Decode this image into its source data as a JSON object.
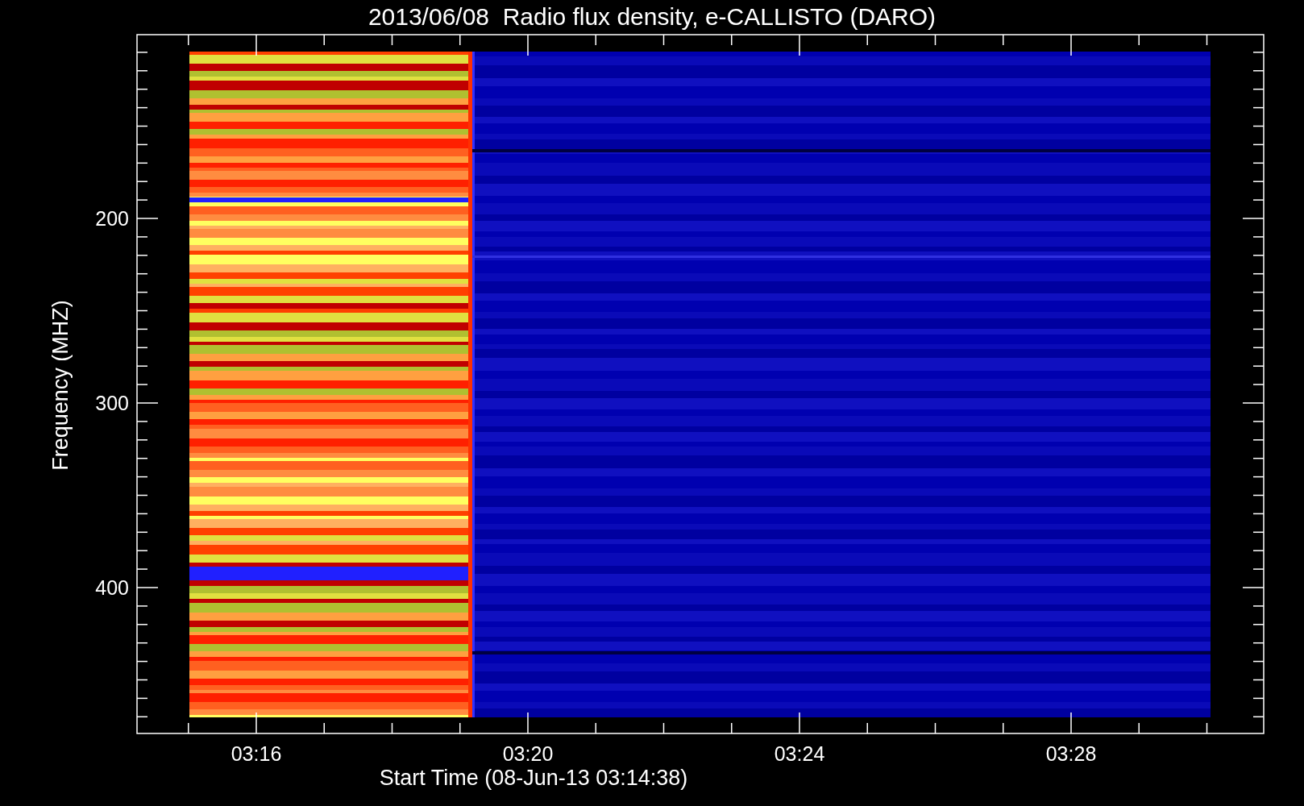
{
  "title": "2013/06/08  Radio flux density, e-CALLISTO (DARO)",
  "y_axis": {
    "label": "Frequency (MHZ)",
    "ticks": [
      "200",
      "300",
      "400"
    ]
  },
  "x_axis": {
    "label": "Start Time (08-Jun-13 03:14:38)",
    "ticks": [
      "03:16",
      "03:20",
      "03:24",
      "03:28"
    ]
  }
}
